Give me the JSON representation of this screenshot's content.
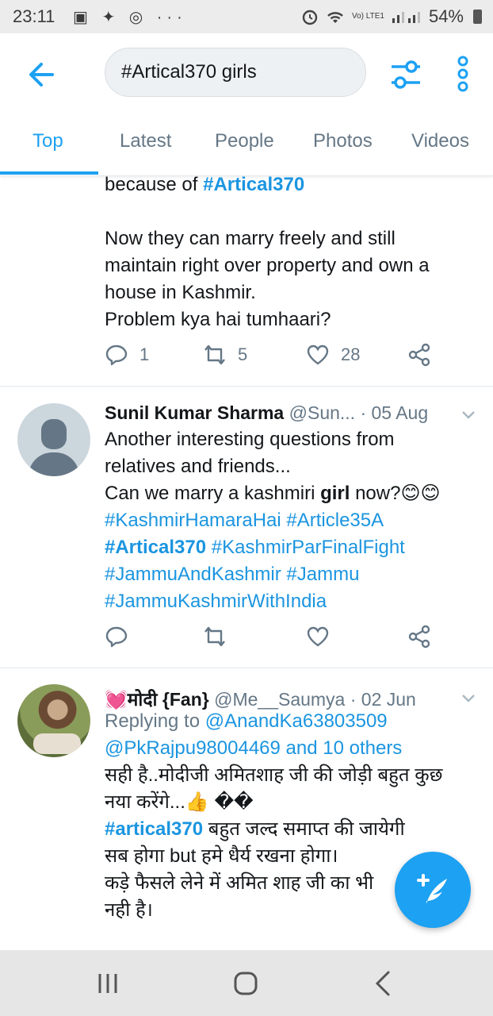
{
  "status_bar": {
    "time": "23:11",
    "left_icons": "▣ ✦ ◎ ···",
    "lte": "Vo) LTE1",
    "battery": "54%"
  },
  "search": {
    "query": "#Artical370 girls"
  },
  "tabs": [
    "Top",
    "Latest",
    "People",
    "Photos",
    "Videos"
  ],
  "tweet1": {
    "l1_pre": "because of ",
    "l1_tag": "#Artical370",
    "l2": "Now they can marry freely and still",
    "l3": "maintain right over property and own a",
    "l4": "house in Kashmir.",
    "l5": "Problem kya hai tumhaari?",
    "replies": "1",
    "retweets": "5",
    "likes": "28"
  },
  "tweet2": {
    "name": "Sunil Kumar Sharma",
    "handle": "@Sun... · 05 Aug",
    "l1": "Another interesting questions from",
    "l2": "relatives and friends...",
    "l3_pre": "Can we marry a kashmiri ",
    "l3_bold": "girl",
    "l3_post": " now?😊😊",
    "l4": "#KashmirHamaraHai #Article35A",
    "l5_tag": "#Artical370",
    "l5_rest": " #KashmirParFinalFight",
    "l6": "#JammuAndKashmir #Jammu",
    "l7": "#JammuKashmirWithIndia"
  },
  "tweet3": {
    "name": "💓मोदी {Fan}",
    "handle": "@Me__Saumya · 02 Jun",
    "reply_pre": "Replying to ",
    "reply_to": "@AnandKa63803509",
    "reply_l2": "@PkRajpu98004469 and 10 others",
    "l1": "सही है..मोदीजी अमितशाह जी की जोड़ी बहुत कुछ",
    "l2": "नया करेंगे...👍 ��",
    "l3_tag": "#artical370",
    "l3_rest": "  बहुत जल्द समाप्त की जायेगी",
    "l4": "सब होगा but हमे धैर्य रखना होगा।",
    "l5": "कड़े फैसले लेने में अमित शाह जी का भी",
    "l6": "नही है।"
  },
  "colors": {
    "accent": "#1da1f2",
    "link": "#1b95e0",
    "muted": "#657786"
  },
  "icons": [
    "back-arrow-icon",
    "filter-icon",
    "more-vertical-icon",
    "reply-icon",
    "retweet-icon",
    "like-icon",
    "share-icon",
    "compose-icon",
    "caret-down-icon"
  ]
}
